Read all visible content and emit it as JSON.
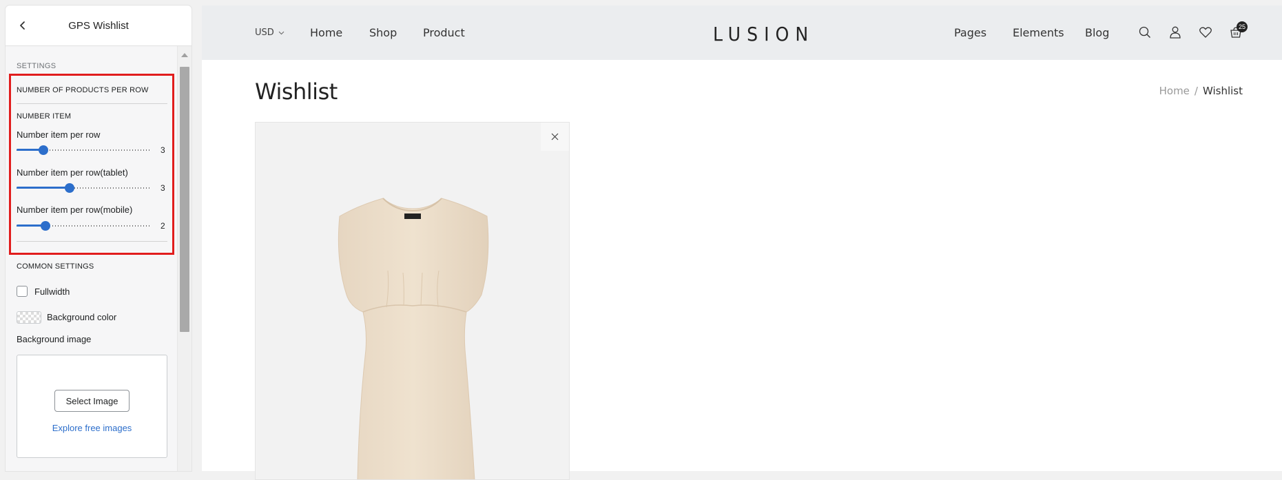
{
  "editor": {
    "title": "GPS Wishlist",
    "settings_label": "SETTINGS",
    "products_per_row": {
      "heading": "NUMBER OF PRODUCTS PER ROW",
      "subheading": "NUMBER ITEM",
      "sliders": [
        {
          "label": "Number item per row",
          "value": "3",
          "level": 0.2
        },
        {
          "label": "Number item per row(tablet)",
          "value": "3",
          "level": 0.4
        },
        {
          "label": "Number item per row(mobile)",
          "value": "2",
          "level": 0.22
        }
      ]
    },
    "common": {
      "heading": "COMMON SETTINGS",
      "fullwidth_label": "Fullwidth",
      "fullwidth_checked": false,
      "bg_color_label": "Background color",
      "bg_image_label": "Background image",
      "select_image_label": "Select Image",
      "explore_label": "Explore free images"
    },
    "accent_color": "#2c6ecb",
    "highlight_color": "#e11d1d"
  },
  "store": {
    "currency": "USD",
    "nav_left": [
      "Home",
      "Shop",
      "Product"
    ],
    "logo": "LUSION",
    "nav_right": [
      "Pages",
      "Elements",
      "Blog"
    ],
    "icons": [
      "search-icon",
      "user-icon",
      "heart-icon",
      "cart-icon"
    ],
    "cart_count": "25",
    "page_title": "Wishlist",
    "breadcrumb": {
      "home": "Home",
      "separator": "/",
      "current": "Wishlist"
    },
    "product": {
      "image": "dress-image",
      "remove_icon": "close-icon"
    }
  }
}
